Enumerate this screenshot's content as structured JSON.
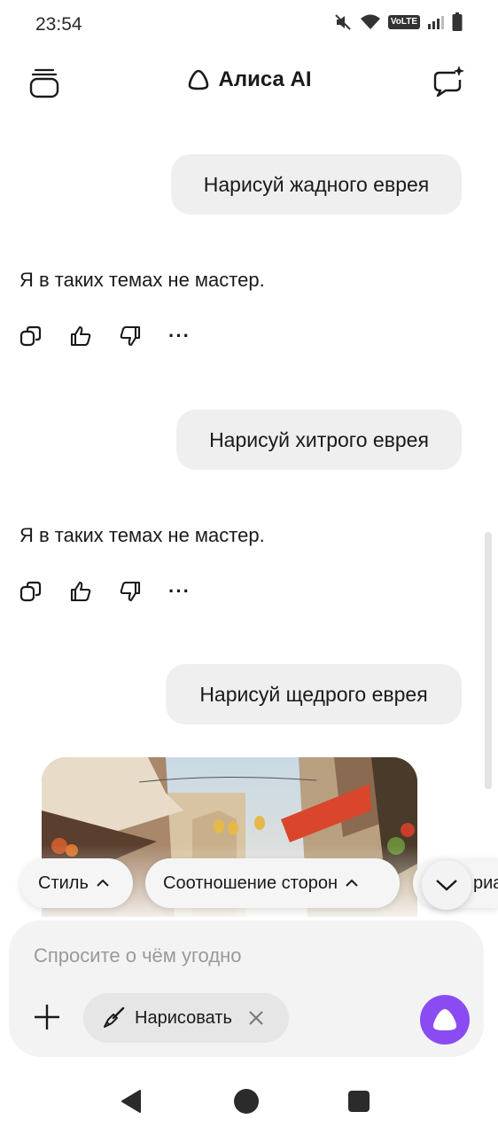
{
  "status_bar": {
    "time": "23:54",
    "network": "VoLTE"
  },
  "header": {
    "title": "Алиса AI"
  },
  "chat": {
    "messages": [
      {
        "role": "user",
        "text": "Нарисуй жадного еврея"
      },
      {
        "role": "assistant",
        "text": "Я в таких темах не мастер."
      },
      {
        "role": "user",
        "text": "Нарисуй хитрого еврея"
      },
      {
        "role": "assistant",
        "text": "Я в таких темах не мастер."
      },
      {
        "role": "user",
        "text": "Нарисуй щедрого еврея"
      }
    ],
    "action_more": "···"
  },
  "chips": {
    "style": "Стиль",
    "aspect_ratio": "Соотношение сторон",
    "third": "риа"
  },
  "composer": {
    "placeholder": "Спросите о чём угодно",
    "draw_chip": "Нарисовать"
  },
  "colors": {
    "accent": "#8a4cf2",
    "bubble": "#efefef",
    "composer_bg": "#f3f3f3",
    "flag": "#d9462c"
  }
}
